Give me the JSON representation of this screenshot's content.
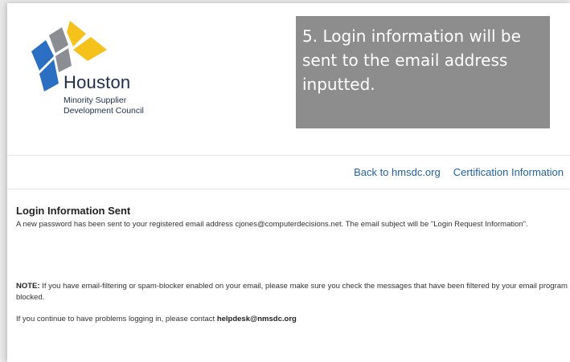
{
  "logo": {
    "title": "Houston",
    "subtitle_line1": "Minority Supplier",
    "subtitle_line2": "Development Council",
    "colors": {
      "blue": "#2b6fc2",
      "gray": "#8a8d92",
      "yellow": "#f4c21b"
    }
  },
  "callout": {
    "text": "5. Login information will be sent to the email address inputted."
  },
  "nav": {
    "links": [
      "Back to hmsdc.org",
      "Certification Information"
    ]
  },
  "content": {
    "title": "Login Information Sent",
    "message": "A new password has been sent to your registered email address cjones@computerdecisions.net. The email subject will be \"Login Request Information\".",
    "note_label": "NOTE:",
    "note_text": " If you have email-filtering or spam-blocker enabled on your email, please make sure you check the messages that have been filtered by your email program or blocked.",
    "contact_prefix": "If you continue to have problems logging in, please contact ",
    "contact_email": "helpdesk@nmsdc.org"
  }
}
